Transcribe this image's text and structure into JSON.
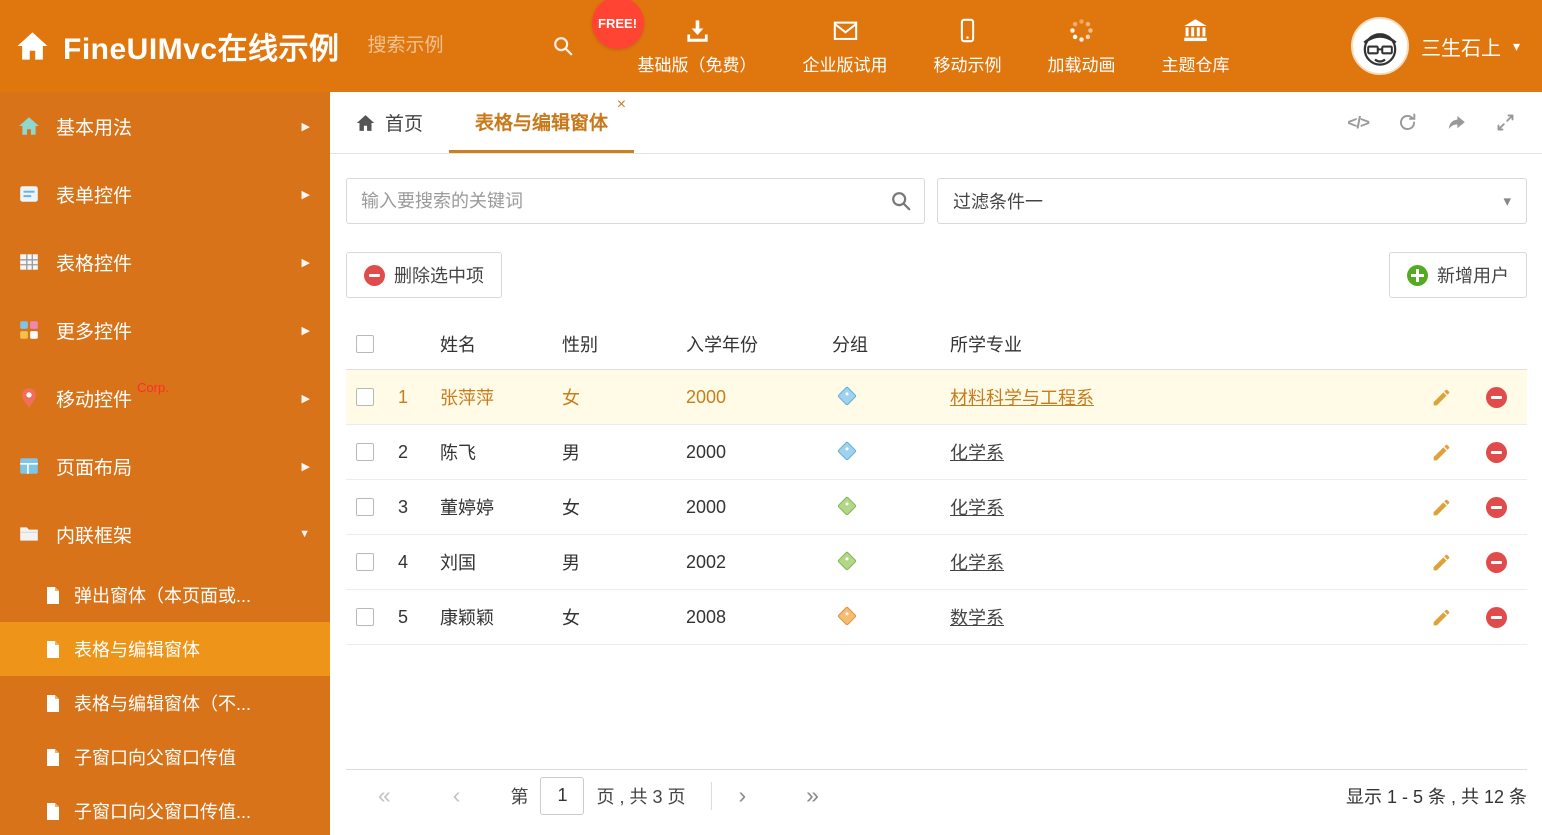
{
  "theme": {
    "header_bg": "#e0770e",
    "sidebar_bg": "#d8731a",
    "sidebar_selected_bg": "#ee9418",
    "accent": "#c8791c",
    "free_badge_bg": "#ff4433",
    "selected_row_bg": "#fffbe6",
    "delete_red": "#e04c4c",
    "add_green": "#54ab22"
  },
  "icons": {
    "caret_down": "▾",
    "arrow_right": "▶",
    "arrow_down": "▼",
    "close": "×",
    "code": "</>",
    "page_first": "«",
    "page_prev": "‹",
    "page_next": "›",
    "page_last": "»"
  },
  "header": {
    "title": "FineUIMvc在线示例",
    "search_placeholder": "搜索示例",
    "free_badge": "FREE!",
    "nav": [
      {
        "label": "基础版（免费）",
        "icon": "download-icon"
      },
      {
        "label": "企业版试用",
        "icon": "envelope-icon"
      },
      {
        "label": "移动示例",
        "icon": "mobile-icon"
      },
      {
        "label": "加载动画",
        "icon": "spinner-icon"
      },
      {
        "label": "主题仓库",
        "icon": "bank-icon"
      }
    ],
    "user": "三生石上"
  },
  "sidebar": {
    "items": [
      {
        "label": "基本用法",
        "icon": "home-icon"
      },
      {
        "label": "表单控件",
        "icon": "form-icon"
      },
      {
        "label": "表格控件",
        "icon": "table-icon"
      },
      {
        "label": "更多控件",
        "icon": "blocks-icon"
      },
      {
        "label": "移动控件",
        "badge": "Corp.",
        "icon": "pin-icon"
      },
      {
        "label": "页面布局",
        "icon": "layout-icon"
      },
      {
        "label": "内联框架",
        "icon": "folder-icon",
        "expanded": true
      }
    ],
    "subitems": [
      {
        "label": "弹出窗体（本页面或..."
      },
      {
        "label": "表格与编辑窗体",
        "active": true
      },
      {
        "label": "表格与编辑窗体（不..."
      },
      {
        "label": "子窗口向父窗口传值"
      },
      {
        "label": "子窗口向父窗口传值..."
      }
    ]
  },
  "tabs": [
    {
      "label": "首页",
      "icon": "home-icon"
    },
    {
      "label": "表格与编辑窗体",
      "active": true,
      "closable": true
    }
  ],
  "toolbar": {
    "search_placeholder": "输入要搜索的关键词",
    "filter_value": "过滤条件一",
    "delete_button": "删除选中项",
    "add_button": "新增用户"
  },
  "table": {
    "columns": [
      "姓名",
      "性别",
      "入学年份",
      "分组",
      "所学专业"
    ],
    "rows": [
      {
        "num": "1",
        "name": "张萍萍",
        "gender": "女",
        "year": "2000",
        "tag_color": "blue",
        "major": "材料科学与工程系",
        "selected": true
      },
      {
        "num": "2",
        "name": "陈飞",
        "gender": "男",
        "year": "2000",
        "tag_color": "blue",
        "major": "化学系"
      },
      {
        "num": "3",
        "name": "董婷婷",
        "gender": "女",
        "year": "2000",
        "tag_color": "green",
        "major": "化学系"
      },
      {
        "num": "4",
        "name": "刘国",
        "gender": "男",
        "year": "2002",
        "tag_color": "green",
        "major": "化学系"
      },
      {
        "num": "5",
        "name": "康颖颖",
        "gender": "女",
        "year": "2008",
        "tag_color": "orange",
        "major": "数学系"
      }
    ]
  },
  "pagination": {
    "label_page": "第",
    "current_page": "1",
    "label_total": "页 , 共 3 页",
    "summary": "显示 1 - 5 条 , 共 12 条"
  }
}
